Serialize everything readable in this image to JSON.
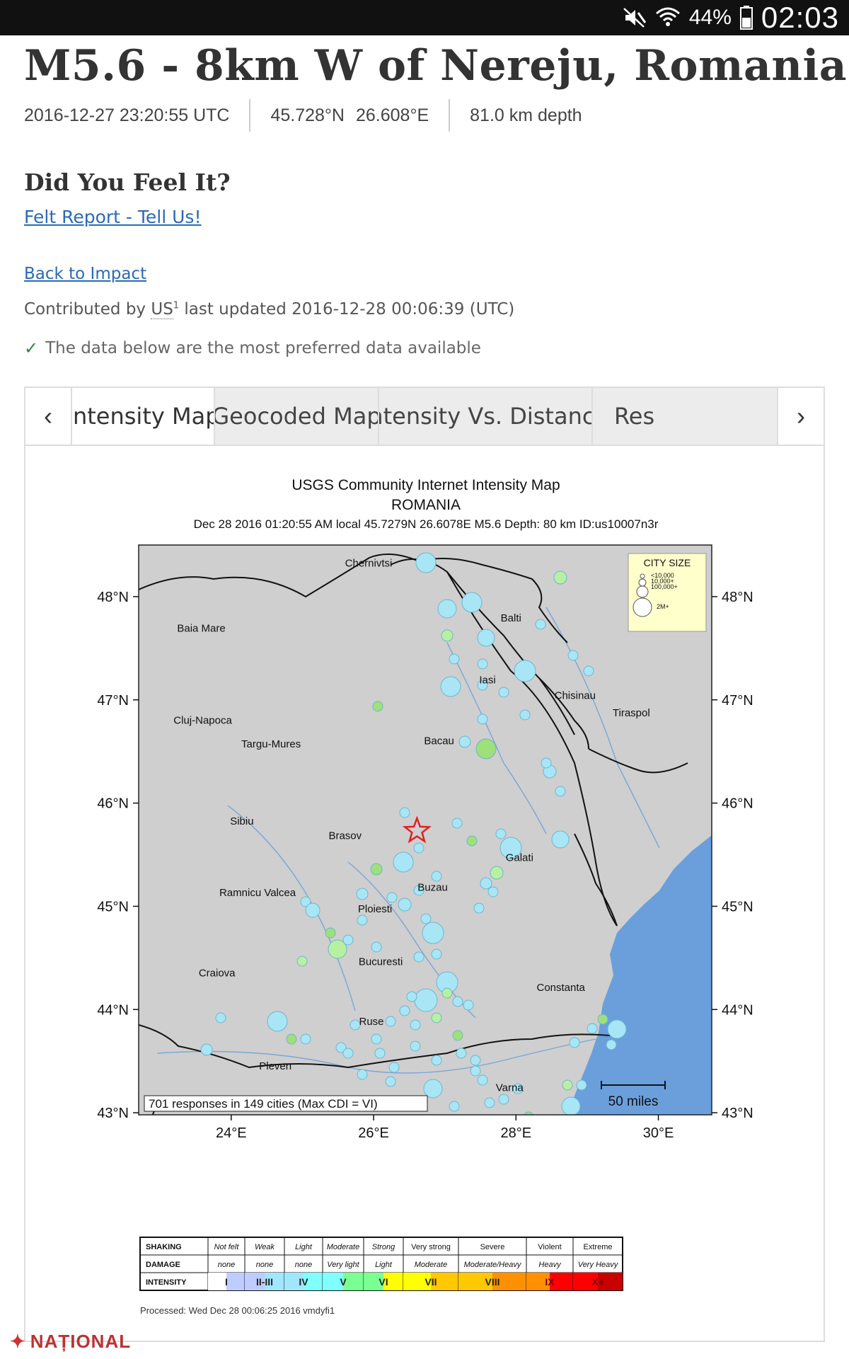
{
  "status_bar": {
    "battery_text": "44%",
    "time": "02:03",
    "icons": [
      "mute-icon",
      "wifi-icon",
      "battery-icon"
    ]
  },
  "event": {
    "title": "M5.6 - 8km W of Nereju, Romania",
    "datetime": "2016-12-27 23:20:55 UTC",
    "lat": "45.728°N",
    "lon": "26.608°E",
    "depth": "81.0 km depth"
  },
  "feel": {
    "heading": "Did You Feel It?",
    "link": "Felt Report - Tell Us!"
  },
  "back_link": "Back to Impact",
  "contrib": {
    "prefix": "Contributed by",
    "source": "US",
    "sup": "1",
    "updated": "last updated 2016-12-28 00:06:39 (UTC)"
  },
  "preferred_note": "The data below are the most preferred data available",
  "tabs": [
    {
      "label": "Intensity Map",
      "active": true
    },
    {
      "label": "Geocoded Map",
      "active": false
    },
    {
      "label": "Intensity Vs. Distance",
      "active": false
    },
    {
      "label": "Res",
      "active": false
    }
  ],
  "map": {
    "title1": "USGS Community Internet Intensity Map",
    "title2": "ROMANIA",
    "subtitle": "Dec 28 2016 01:20:55 AM local 45.7279N 26.6078E M5.6 Depth: 80 km ID:us10007n3r",
    "lat_labels": [
      "48°N",
      "47°N",
      "46°N",
      "45°N",
      "44°N",
      "43°N"
    ],
    "lon_labels": [
      "24°E",
      "26°E",
      "28°E",
      "30°E"
    ],
    "city_size_title": "CITY SIZE",
    "city_size_entries": [
      "<10,000",
      "10,000+",
      "100,000+",
      "2M+"
    ],
    "responses": "701 responses in 149 cities (Max CDI = VI)",
    "scale_label": "50 miles",
    "cities": [
      {
        "name": "Chernivtsi",
        "lon": 25.93,
        "lat": 48.29
      },
      {
        "name": "Balti",
        "lon": 27.93,
        "lat": 47.76
      },
      {
        "name": "Baia Mare",
        "lon": 23.58,
        "lat": 47.66
      },
      {
        "name": "Iasi",
        "lon": 27.6,
        "lat": 47.16
      },
      {
        "name": "Chisinau",
        "lon": 28.83,
        "lat": 47.01
      },
      {
        "name": "Tiraspol",
        "lon": 29.62,
        "lat": 46.84
      },
      {
        "name": "Cluj-Napoca",
        "lon": 23.6,
        "lat": 46.77
      },
      {
        "name": "Targu-Mures",
        "lon": 24.56,
        "lat": 46.54
      },
      {
        "name": "Bacau",
        "lon": 26.92,
        "lat": 46.57
      },
      {
        "name": "Sibiu",
        "lon": 24.15,
        "lat": 45.79
      },
      {
        "name": "Brasov",
        "lon": 25.6,
        "lat": 45.65
      },
      {
        "name": "Galati",
        "lon": 28.05,
        "lat": 45.44
      },
      {
        "name": "Ramnicu Valcea",
        "lon": 24.37,
        "lat": 45.1
      },
      {
        "name": "Buzau",
        "lon": 26.83,
        "lat": 45.15
      },
      {
        "name": "Ploiesti",
        "lon": 26.02,
        "lat": 44.94
      },
      {
        "name": "Bucuresti",
        "lon": 26.1,
        "lat": 44.43
      },
      {
        "name": "Craiova",
        "lon": 23.8,
        "lat": 44.32
      },
      {
        "name": "Constanta",
        "lon": 28.63,
        "lat": 44.18
      },
      {
        "name": "Ruse",
        "lon": 25.97,
        "lat": 43.85
      },
      {
        "name": "Pleven",
        "lon": 24.62,
        "lat": 43.42
      },
      {
        "name": "Varna",
        "lon": 27.91,
        "lat": 43.21
      }
    ],
    "epicenter": {
      "lon": 26.61,
      "lat": 45.73
    },
    "legend": {
      "shaking_label": "SHAKING",
      "damage_label": "DAMAGE",
      "intensity_label": "INTENSITY",
      "shaking": [
        "Not felt",
        "Weak",
        "Light",
        "Moderate",
        "Strong",
        "Very strong",
        "Severe",
        "Violent",
        "Extreme"
      ],
      "damage": [
        "none",
        "none",
        "none",
        "Very light",
        "Light",
        "Moderate",
        "Moderate/Heavy",
        "Heavy",
        "Very Heavy"
      ],
      "intensity": [
        "I",
        "II-III",
        "IV",
        "V",
        "VI",
        "VII",
        "VIII",
        "IX",
        "X+"
      ],
      "colors": [
        "#ffffff",
        "#bfccff",
        "#a0e6ff",
        "#80ffff",
        "#7aff93",
        "#ffff00",
        "#ffc800",
        "#ff9100",
        "#ff0000",
        "#c80000"
      ]
    },
    "processed": "Processed: Wed Dec 28 00:06:25 2016 vmdyfi1",
    "colors": {
      "land": "#cfcfcf",
      "sea": "#6a9fdc",
      "border": "#111111",
      "river": "#7aa6d6",
      "star": "#e02020"
    }
  },
  "footer_logo": "NAȚIONAL"
}
